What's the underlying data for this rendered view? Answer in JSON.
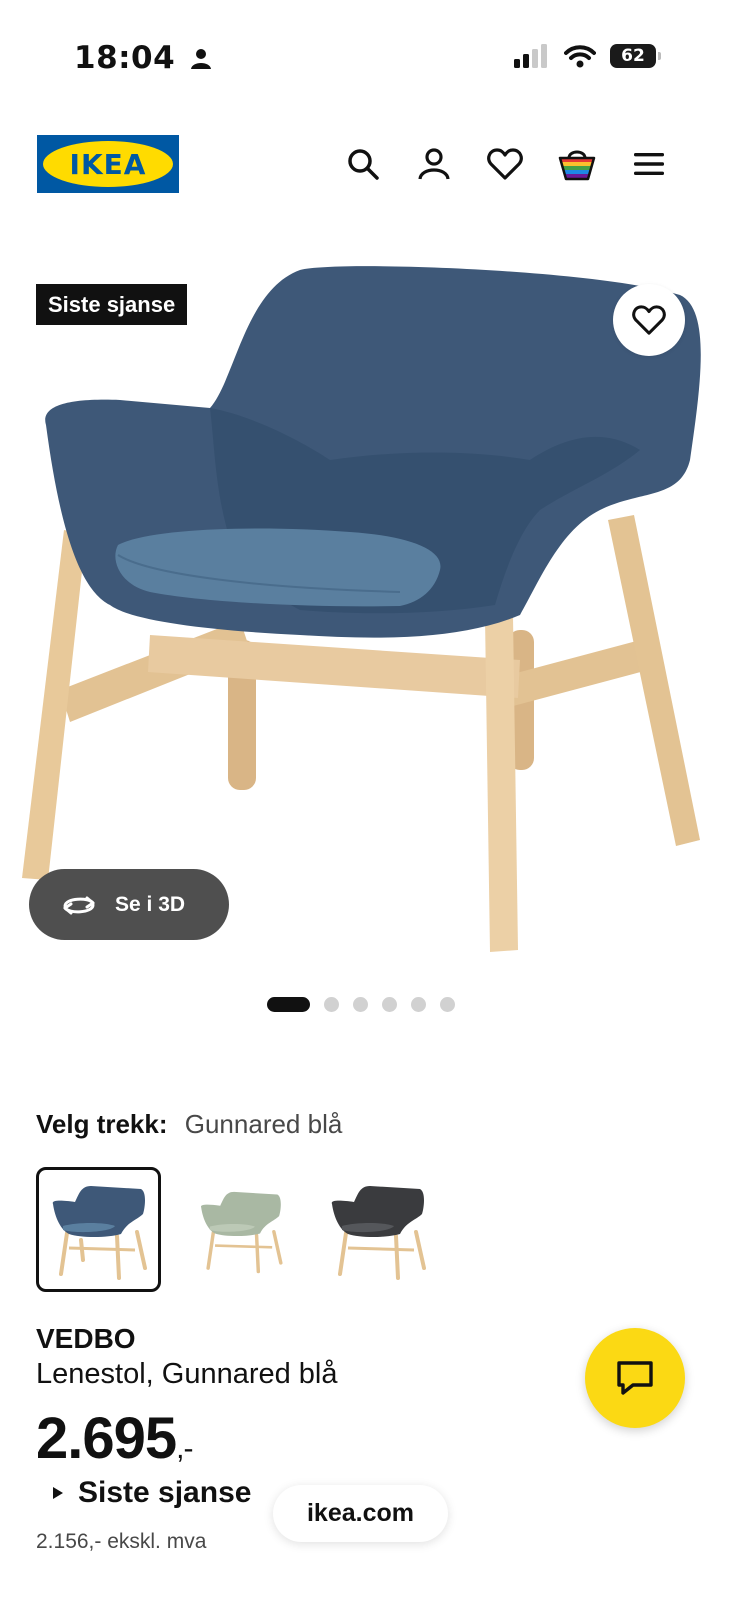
{
  "status_bar": {
    "time": "18:04",
    "battery": "62"
  },
  "header": {
    "logo_text": "IKEA"
  },
  "hero": {
    "badge": "Siste sjanse",
    "view_3d_label": "Se i 3D",
    "image_count": 6,
    "active_image": 1
  },
  "variant": {
    "label": "Velg trekk:",
    "value": "Gunnared blå"
  },
  "product": {
    "name": "VEDBO",
    "description": "Lenestol, Gunnared blå",
    "price": "2.695",
    "price_suffix": ",-",
    "flag": "Siste sjanse",
    "price_ex_vat": "2.156,- ekskl. mva"
  },
  "browser": {
    "url": "ikea.com"
  },
  "colors": {
    "brand_blue": "#0058a3",
    "brand_yellow": "#ffdb00",
    "chair_blue": "#3d5777",
    "wood": "#e8c99a"
  }
}
